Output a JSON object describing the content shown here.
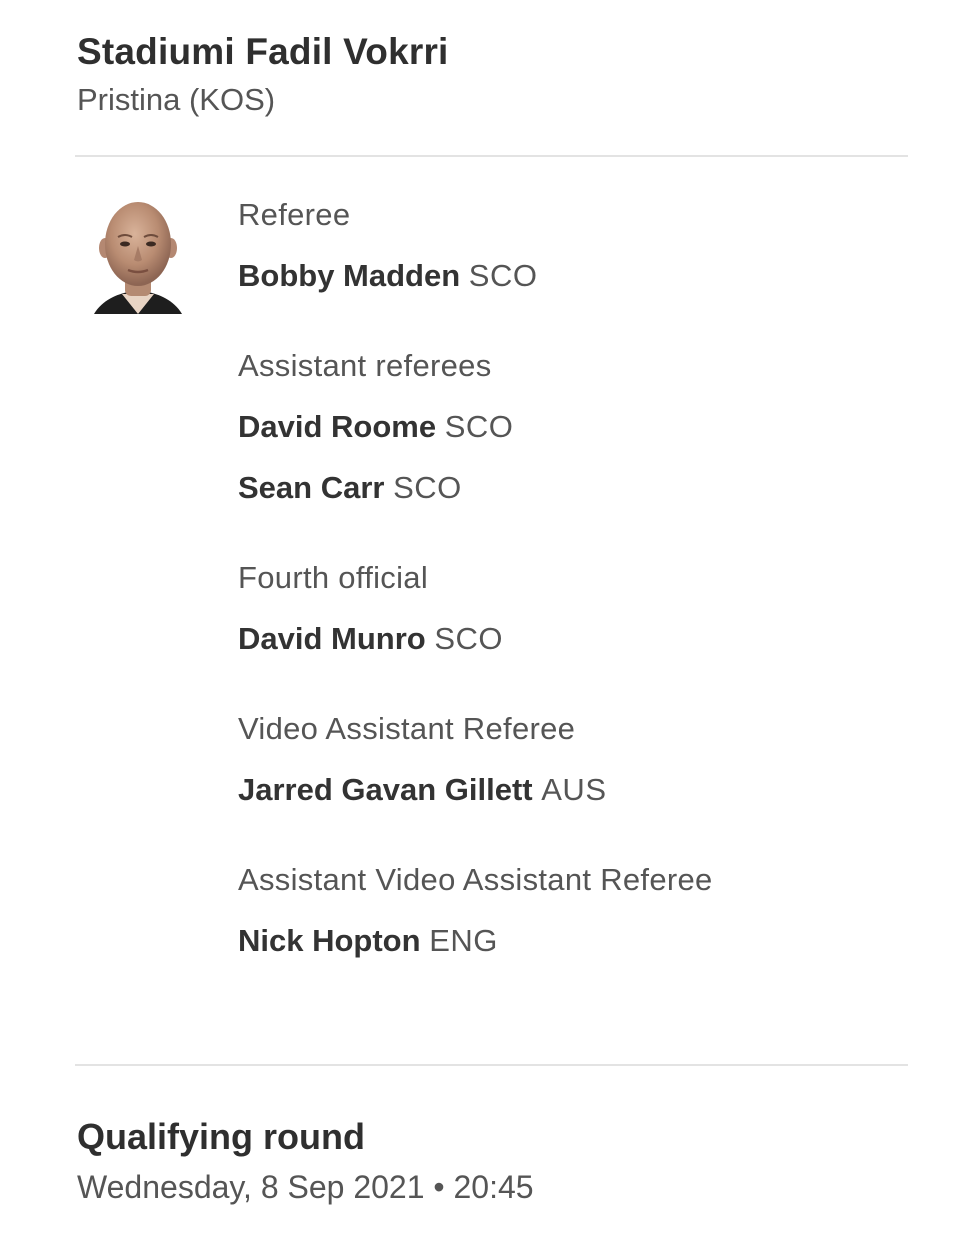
{
  "stadium": {
    "name": "Stadiumi Fadil Vokrri",
    "city": "Pristina (KOS)"
  },
  "referee": {
    "avatar_icon": "referee-portrait-icon"
  },
  "officials": [
    {
      "role": "Referee",
      "people": [
        {
          "name": "Bobby Madden",
          "nationality": "SCO"
        }
      ]
    },
    {
      "role": "Assistant referees",
      "people": [
        {
          "name": "David Roome",
          "nationality": "SCO"
        },
        {
          "name": "Sean Carr",
          "nationality": "SCO"
        }
      ]
    },
    {
      "role": "Fourth official",
      "people": [
        {
          "name": "David Munro",
          "nationality": "SCO"
        }
      ]
    },
    {
      "role": "Video Assistant Referee",
      "people": [
        {
          "name": "Jarred Gavan Gillett",
          "nationality": "AUS"
        }
      ]
    },
    {
      "role": "Assistant Video Assistant Referee",
      "people": [
        {
          "name": "Nick Hopton",
          "nationality": "ENG"
        }
      ]
    }
  ],
  "round": {
    "title": "Qualifying round",
    "date": "Wednesday, 8 Sep 2021 • 20:45"
  }
}
